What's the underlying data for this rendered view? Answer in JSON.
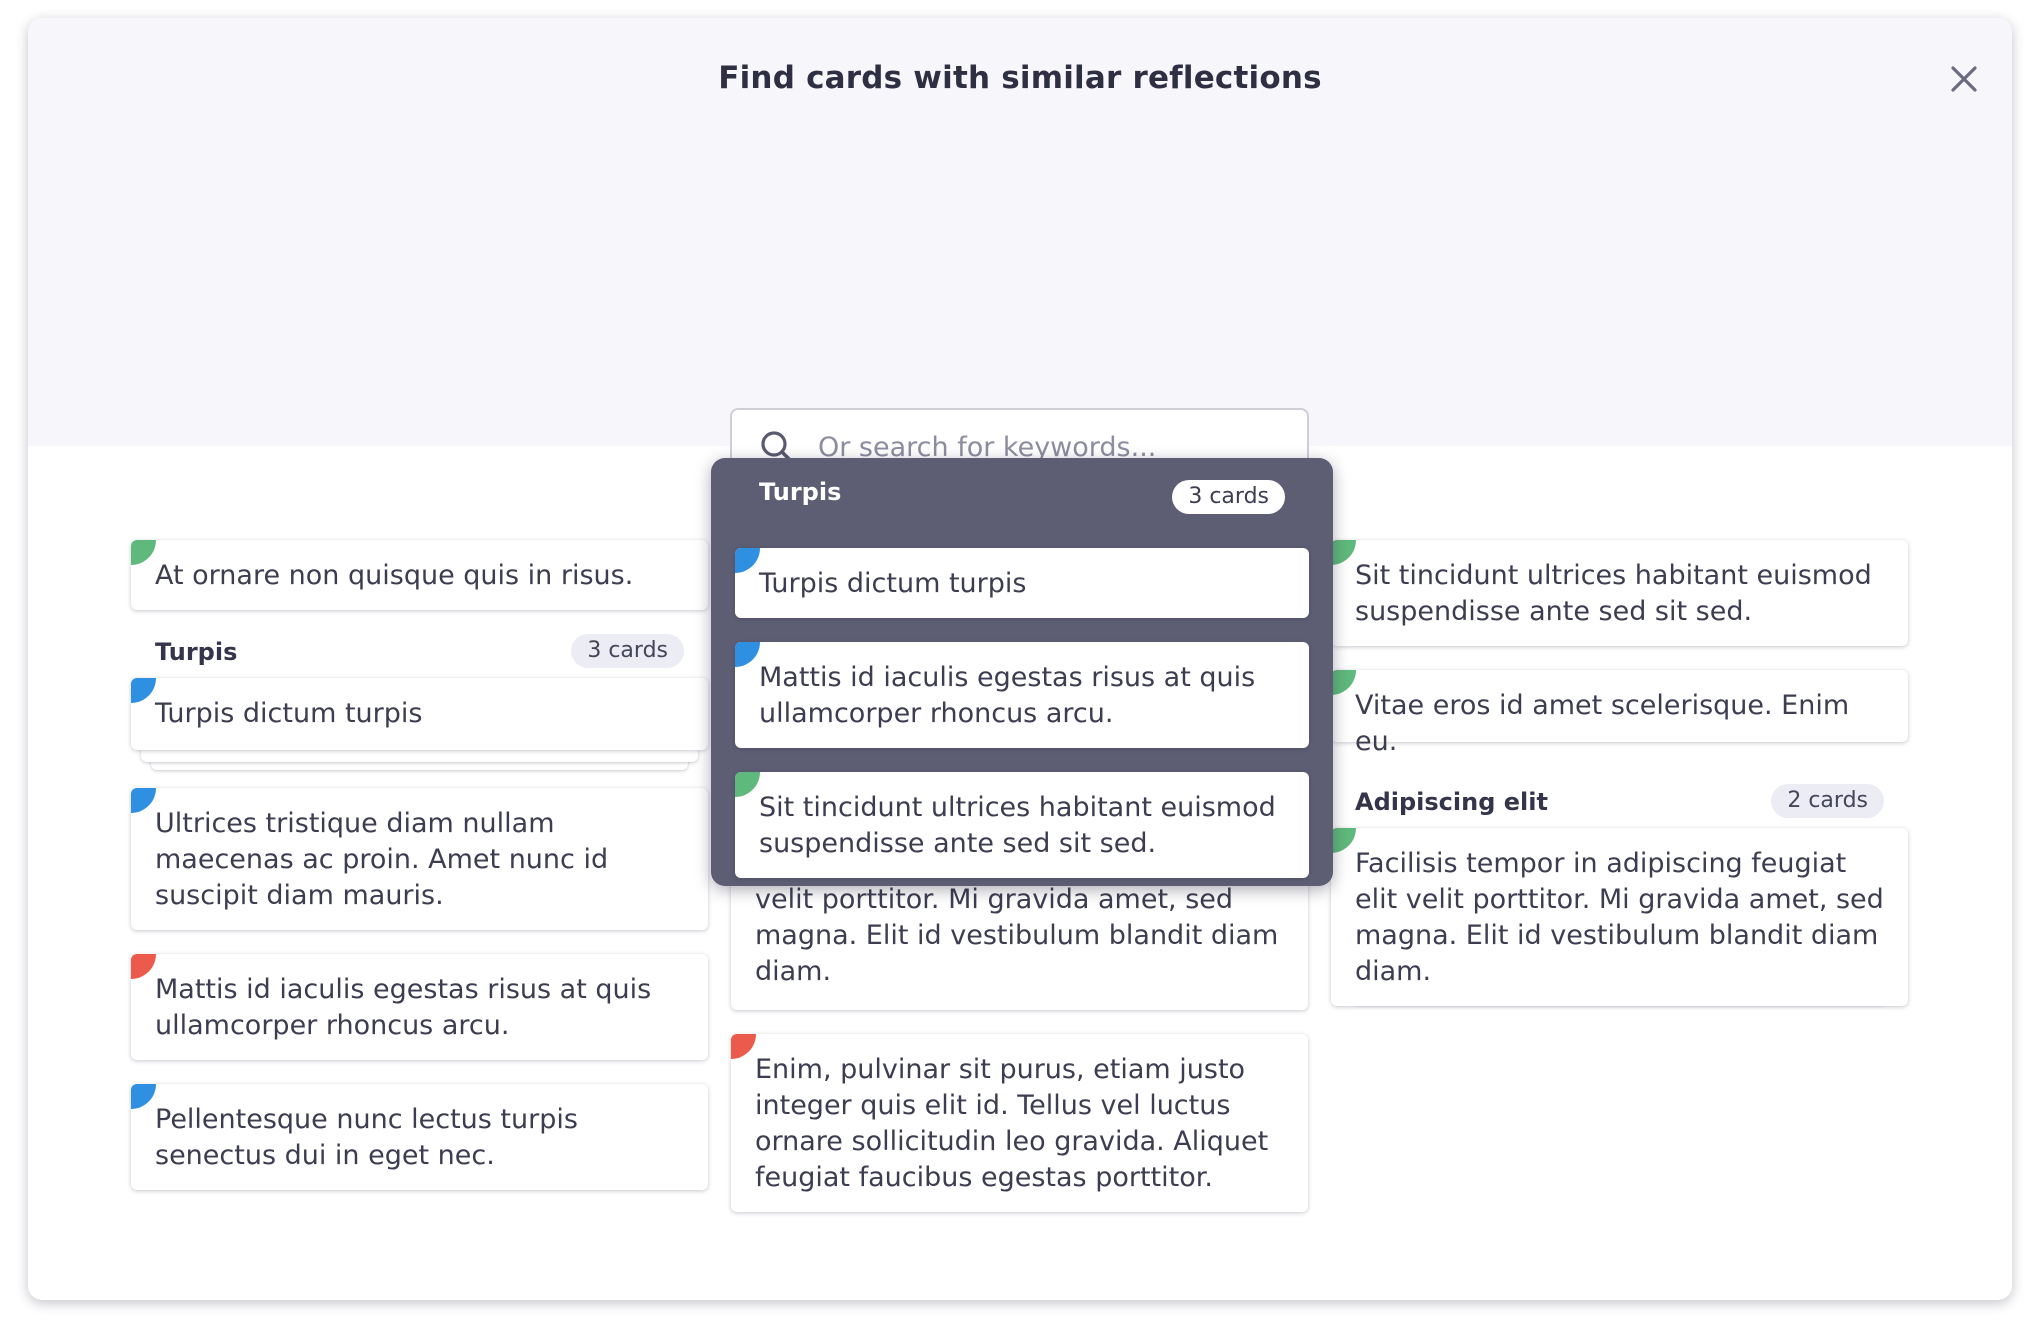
{
  "dialog": {
    "title": "Find cards with similar reflections"
  },
  "search": {
    "placeholder": "Or search for keywords..."
  },
  "colors": {
    "green": "#5fb97c",
    "blue": "#2f8fe0",
    "red": "#ec5a4b",
    "popup_bg": "#5d5d73"
  },
  "columns": {
    "left": {
      "card1": "At ornare non quisque quis in risus.",
      "group": {
        "title": "Turpis",
        "count": "3 cards",
        "top_card": "Turpis dictum turpis"
      },
      "card2": "Ultrices tristique diam nullam maecenas ac proin. Amet nunc id suscipit diam mauris.",
      "card3": "Mattis id iaculis egestas risus at quis ullamcorper rhoncus arcu.",
      "card4": "Pellentesque nunc lectus turpis senectus dui in eget nec."
    },
    "middle": {
      "card1": "velit porttitor. Mi gravida amet, sed magna. Elit id vestibulum blandit diam diam.",
      "card2": "Enim, pulvinar sit purus, etiam justo integer quis elit id. Tellus vel luctus ornare sollicitudin leo gravida. Aliquet feugiat faucibus egestas porttitor."
    },
    "right": {
      "card1": "Sit tincidunt ultrices habitant euismod suspendisse ante sed sit sed.",
      "card2": "Vitae eros id amet scelerisque. Enim eu.",
      "group": {
        "title": "Adipiscing elit",
        "count": "2 cards",
        "top_card": "Facilisis tempor in adipiscing feugiat elit velit porttitor. Mi gravida amet, sed magna. Elit id vestibulum blandit diam diam."
      }
    }
  },
  "popup": {
    "title": "Turpis",
    "count": "3 cards",
    "cards": [
      "Turpis dictum turpis",
      "Mattis id iaculis egestas risus at quis ullamcorper rhoncus arcu.",
      "Sit tincidunt ultrices habitant euismod suspendisse ante sed sit sed."
    ]
  }
}
